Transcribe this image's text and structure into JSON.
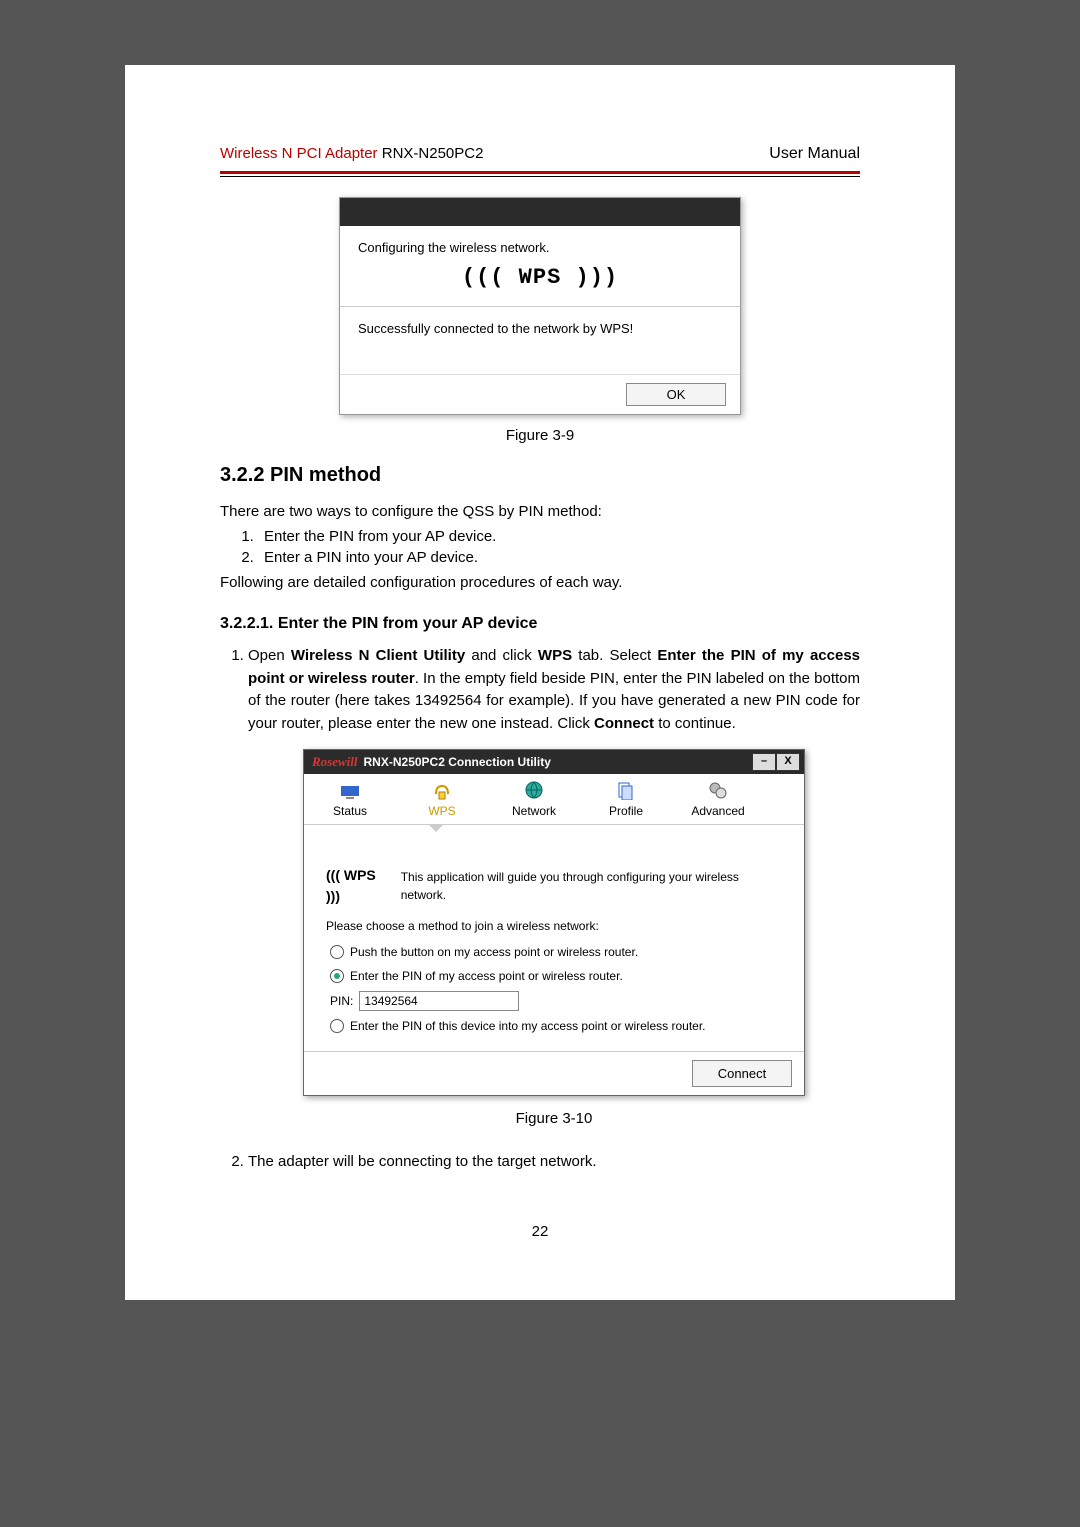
{
  "header": {
    "product_prefix": "Wireless N PCI Adapter",
    "product_model": "RNX-N250PC2",
    "right": "User Manual"
  },
  "fig1": {
    "configuring": "Configuring the wireless network.",
    "wps_logo": "((( WPS )))",
    "success": "Successfully connected to the network by WPS!",
    "ok": "OK",
    "caption": "Figure 3-9"
  },
  "section": {
    "title": "3.2.2 PIN method",
    "intro": "There are two ways to configure the QSS by PIN method:",
    "item1": "Enter the PIN from your AP device.",
    "item2": "Enter a PIN into your AP device.",
    "follow": "Following are detailed configuration procedures of each way."
  },
  "subsection": {
    "title": "3.2.2.1.  Enter the PIN from your AP device",
    "step1_a": "Open ",
    "step1_b": "Wireless N Client Utility",
    "step1_c": " and click ",
    "step1_d": "WPS",
    "step1_e": " tab. Select ",
    "step1_f": "Enter the PIN of my access point or wireless router",
    "step1_g": ". In the empty field beside PIN, enter the PIN labeled on the bottom of the router (here takes 13492564 for example). If you have generated a new PIN code for your router, please enter the new one instead. Click ",
    "step1_h": "Connect",
    "step1_i": " to continue.",
    "step2": "The adapter will be connecting to the target network."
  },
  "util": {
    "brand": "Rosewill",
    "title": "RNX-N250PC2 Connection Utility",
    "tabs": {
      "status": "Status",
      "wps": "WPS",
      "network": "Network",
      "profile": "Profile",
      "advanced": "Advanced"
    },
    "wps_mini": "((( WPS )))",
    "guide": "This application will guide you through configuring your wireless network.",
    "choose": "Please choose a method to join a wireless network:",
    "opt1": "Push the button on my access point or wireless router.",
    "opt2": "Enter the PIN of my access point or wireless router.",
    "pin_label": "PIN:",
    "pin_value": "13492564",
    "opt3": "Enter the PIN of this device into my access point or wireless router.",
    "connect": "Connect",
    "caption": "Figure 3-10"
  },
  "page_num": "22"
}
